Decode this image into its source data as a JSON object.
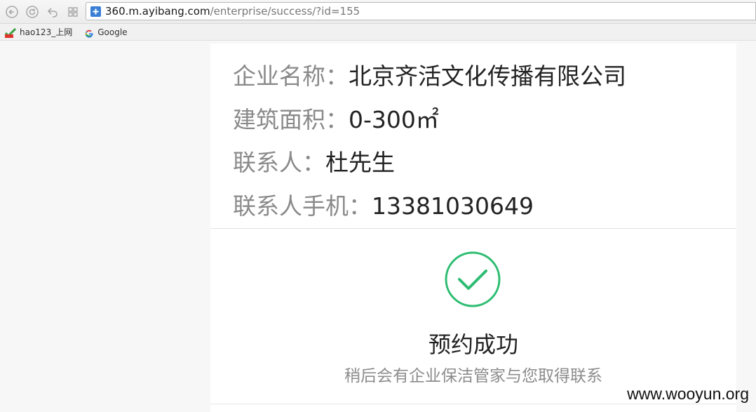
{
  "browser": {
    "url_host": "360.m.ayibang.com",
    "url_path": "/enterprise/success/?id=155",
    "bookmarks": [
      {
        "label": "hao123_上网",
        "icon": "hao123-icon"
      },
      {
        "label": "Google",
        "icon": "google-icon"
      }
    ]
  },
  "info": {
    "company_label": "企业名称：",
    "company_value": "北京齐活文化传播有限公司",
    "area_label": "建筑面积：",
    "area_value": "0-300㎡",
    "contact_label": "联系人：",
    "contact_value": "杜先生",
    "phone_label": "联系人手机：",
    "phone_value": "13381030649"
  },
  "result": {
    "title": "预约成功",
    "subtitle": "稍后会有企业保洁管家与您取得联系",
    "accent_color": "#2ebd72"
  },
  "watermark": "www.wooyun.org"
}
